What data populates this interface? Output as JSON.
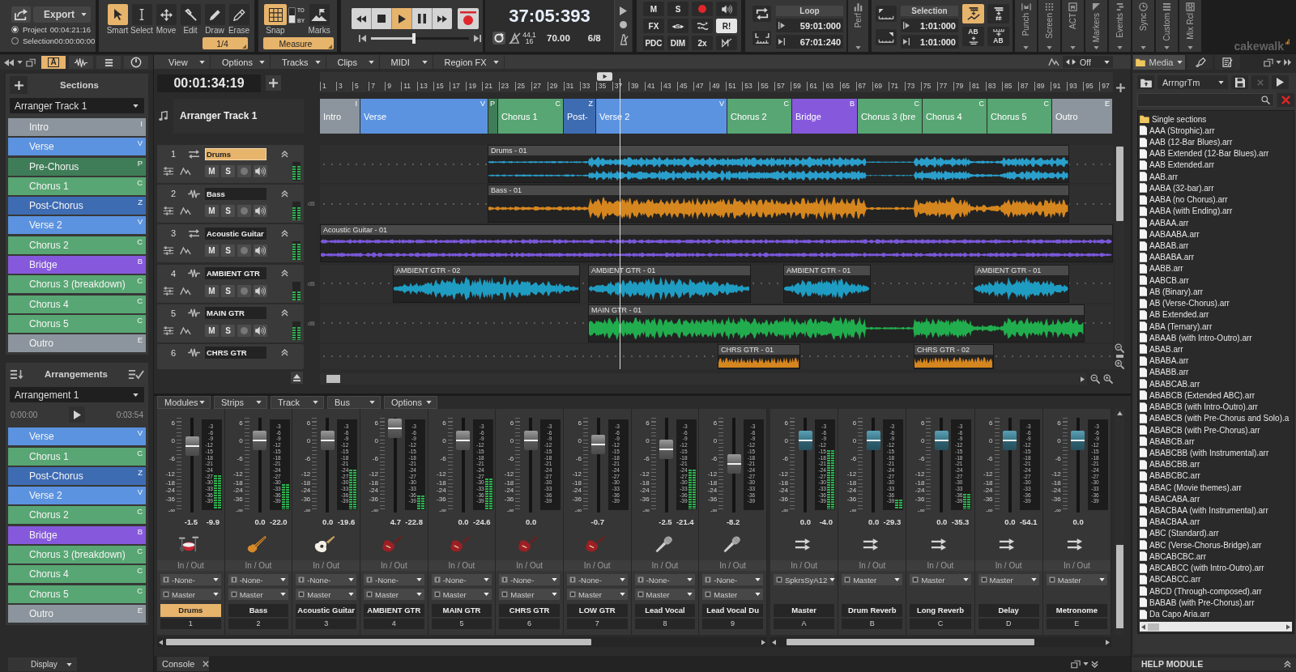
{
  "control_bar": {
    "export": {
      "label": "Export",
      "ranges": [
        {
          "label": "Project",
          "time": "00:04:21:16",
          "selected": true
        },
        {
          "label": "Selection",
          "time": "00:00:00:00",
          "selected": false
        }
      ]
    },
    "tools": {
      "items": [
        {
          "kind": "smart",
          "label": "Smart",
          "selected": true
        },
        {
          "kind": "select",
          "label": "Select",
          "selected": false
        },
        {
          "kind": "move",
          "label": "Move",
          "selected": false
        },
        {
          "kind": "edit",
          "label": "Edit",
          "selected": false
        },
        {
          "kind": "draw",
          "label": "Draw",
          "selected": false
        },
        {
          "kind": "erase",
          "label": "Erase",
          "selected": false
        }
      ],
      "resolution": "1/4"
    },
    "snap": {
      "label": "Snap",
      "on": true,
      "to_label": "TO",
      "by_label": "BY",
      "by": true,
      "marks_label": "Marks",
      "mode": "Measure"
    },
    "transport": {
      "buttons": [
        {
          "kind": "rewind",
          "on": false
        },
        {
          "kind": "stop",
          "on": false
        },
        {
          "kind": "play",
          "on": true
        },
        {
          "kind": "pause",
          "on": false
        },
        {
          "kind": "fast-forward",
          "on": false
        }
      ],
      "record": {
        "on": false
      },
      "position": {
        "level": 0.44
      }
    },
    "clock": {
      "time": "37:05:393",
      "sample_rate": "44.1",
      "bit_depth": "16",
      "tempo": "70.00",
      "meter": "6/8"
    },
    "mix": [
      {
        "kind": "text",
        "label": "M",
        "on": false
      },
      {
        "kind": "text",
        "label": "S",
        "on": false
      },
      {
        "kind": "record",
        "on": false
      },
      {
        "kind": "audio",
        "on": false
      },
      {
        "kind": "text",
        "label": "FX",
        "on": false
      },
      {
        "kind": "text",
        "label": "◂S▸",
        "on": false
      },
      {
        "kind": "bypass",
        "on": false
      },
      {
        "kind": "text",
        "label": "R!",
        "on": true
      },
      {
        "kind": "text",
        "label": "PDC",
        "on": false
      },
      {
        "kind": "text",
        "label": "DIM",
        "on": false
      },
      {
        "kind": "text",
        "label": "2x",
        "on": false
      },
      {
        "kind": "midi-off",
        "on": false
      }
    ],
    "loop": {
      "label": "Loop",
      "start": "59:01:000",
      "end": "67:01:240"
    },
    "perf": {
      "label": "Perf"
    },
    "selection": {
      "label": "Selection",
      "start": "1:01:000",
      "end": "1:01:000",
      "buttons": [
        {
          "kind": "automation",
          "on": true
        },
        {
          "kind": "tempo",
          "on": false
        },
        {
          "kind": "ab-above",
          "label": "AB",
          "on": false
        },
        {
          "kind": "ab-below",
          "label": "AB",
          "on": false
        }
      ]
    },
    "modules": [
      {
        "kind": "punch",
        "label": "Punch"
      },
      {
        "kind": "screen",
        "label": "Screen"
      },
      {
        "kind": "act",
        "label": "ACT"
      },
      {
        "kind": "markers",
        "label": "Markers"
      },
      {
        "kind": "events",
        "label": "Events"
      },
      {
        "kind": "sync",
        "label": "Sync"
      },
      {
        "kind": "custom",
        "label": "Custom"
      },
      {
        "kind": "mix-recall",
        "label": "Mix Rcl"
      }
    ],
    "logo": "cakewalk"
  },
  "inspector": {
    "tabs": [
      {
        "kind": "arranger",
        "label": "A",
        "selected": true
      },
      {
        "kind": "clip",
        "selected": false
      },
      {
        "kind": "list",
        "selected": false
      },
      {
        "kind": "knob",
        "selected": false
      }
    ],
    "sections": {
      "title": "Sections",
      "track": "Arranger Track 1",
      "items": [
        {
          "name": "Intro",
          "key": "I",
          "color": "#8c959d"
        },
        {
          "name": "Verse",
          "key": "V",
          "color": "#5b93e0"
        },
        {
          "name": "Pre-Chorus",
          "key": "P",
          "color": "#3f7d58"
        },
        {
          "name": "Chorus 1",
          "key": "C",
          "color": "#58a673"
        },
        {
          "name": "Post-Chorus",
          "key": "Z",
          "color": "#3e6cb3"
        },
        {
          "name": "Verse 2",
          "key": "V",
          "color": "#5b93e0"
        },
        {
          "name": "Chorus 2",
          "key": "C",
          "color": "#58a673"
        },
        {
          "name": "Bridge",
          "key": "B",
          "color": "#8659dc"
        },
        {
          "name": "Chorus 3 (breakdown)",
          "key": "C",
          "color": "#58a673"
        },
        {
          "name": "Chorus 4",
          "key": "C",
          "color": "#58a673"
        },
        {
          "name": "Chorus 5",
          "key": "C",
          "color": "#58a673"
        },
        {
          "name": "Outro",
          "key": "E",
          "color": "#8c959d"
        }
      ]
    },
    "arrangements": {
      "title": "Arrangements",
      "name": "Arrangement 1",
      "start": "0:00:00",
      "end": "0:03:54",
      "items": [
        {
          "name": "Verse",
          "key": "V",
          "color": "#5b93e0"
        },
        {
          "name": "Chorus 1",
          "key": "C",
          "color": "#58a673"
        },
        {
          "name": "Post-Chorus",
          "key": "Z",
          "color": "#3e6cb3"
        },
        {
          "name": "Verse 2",
          "key": "V",
          "color": "#5b93e0"
        },
        {
          "name": "Chorus 2",
          "key": "C",
          "color": "#58a673"
        },
        {
          "name": "Bridge",
          "key": "B",
          "color": "#8659dc"
        },
        {
          "name": "Chorus 3 (breakdown)",
          "key": "C",
          "color": "#58a673"
        },
        {
          "name": "Chorus 4",
          "key": "C",
          "color": "#58a673"
        },
        {
          "name": "Chorus 5",
          "key": "C",
          "color": "#58a673"
        },
        {
          "name": "Outro",
          "key": "E",
          "color": "#8c959d"
        }
      ]
    },
    "display": "Display"
  },
  "track_view": {
    "menu": [
      "View",
      "Options",
      "Tracks",
      "Clips",
      "MIDI",
      "Region FX"
    ],
    "dropdown": "Off",
    "now": "00:01:34:19",
    "ruler": [
      "1",
      "3",
      "5",
      "7",
      "9",
      "11",
      "13",
      "15",
      "17",
      "19",
      "21",
      "23",
      "25",
      "27",
      "29",
      "31",
      "33",
      "35",
      "37",
      "39",
      "41",
      "43",
      "45",
      "47",
      "49",
      "51",
      "53",
      "55",
      "57",
      "59",
      "61",
      "63",
      "65",
      "67",
      "69",
      "71",
      "73",
      "75",
      "77",
      "79",
      "81",
      "83",
      "85",
      "87",
      "89",
      "91",
      "93",
      "95",
      "97"
    ],
    "arranger": {
      "name": "Arranger Track 1",
      "sections": [
        {
          "name": "Intro",
          "key": "I",
          "color": "#8c959d"
        },
        {
          "name": "Verse",
          "key": "V",
          "color": "#5b93e0"
        },
        {
          "key": "P",
          "color": "#3f7d58"
        },
        {
          "name": "Chorus 1",
          "key": "C",
          "color": "#58a673"
        },
        {
          "name": "Post-",
          "key": "Z",
          "color": "#3e6cb3"
        },
        {
          "name": "Verse 2",
          "key": "V",
          "color": "#5b93e0"
        },
        {
          "name": "Chorus 2",
          "key": "C",
          "color": "#58a673"
        },
        {
          "name": "Bridge",
          "key": "B",
          "color": "#8659dc"
        },
        {
          "name": "Chorus 3 (bre",
          "key": "C",
          "color": "#58a673"
        },
        {
          "name": "Chorus 4",
          "key": "C",
          "color": "#58a673"
        },
        {
          "name": "Chorus 5",
          "key": "C",
          "color": "#58a673"
        },
        {
          "name": "Outro",
          "key": "E",
          "color": "#8c959d"
        }
      ]
    },
    "tracks": [
      {
        "number": "1",
        "name": "Drums",
        "kind": "stereo",
        "selected": true,
        "color": "#2a9fcc",
        "buttons": [
          "M",
          "S"
        ],
        "meter": {
          "level": 0.8
        },
        "clips": [
          {
            "name": "Drums - 01"
          }
        ]
      },
      {
        "number": "2",
        "name": "Bass",
        "kind": "mono",
        "selected": false,
        "color": "#d5861e",
        "buttons": [
          "M",
          "S"
        ],
        "meter": {
          "level": 0.7
        },
        "gain_label": "dB",
        "clips": [
          {
            "name": "Bass - 01"
          }
        ]
      },
      {
        "number": "3",
        "name": "Acoustic Guitar",
        "kind": "stereo",
        "selected": false,
        "color": "#7a57d8",
        "buttons": [
          "M",
          "S"
        ],
        "meter": {
          "level": 0.9
        },
        "clips": [
          {
            "name": "Acoustic Guitar - 01"
          }
        ]
      },
      {
        "number": "4",
        "name": "AMBIENT GTR",
        "kind": "mono",
        "selected": false,
        "color": "#1f9cc2",
        "buttons": [
          "M",
          "S"
        ],
        "meter": {
          "level": 0.45
        },
        "gain_label": "dB",
        "clips": [
          {
            "name": "AMBIENT GTR - 02"
          },
          {
            "name": "AMBIENT GTR - 01"
          },
          {
            "name": "AMBIENT GTR - 01"
          },
          {
            "name": "AMBIENT GTR - 01"
          }
        ]
      },
      {
        "number": "5",
        "name": "MAIN GTR",
        "kind": "mono",
        "selected": false,
        "color": "#21ad4d",
        "buttons": [
          "M",
          "S"
        ],
        "meter": {
          "level": 0.7
        },
        "gain_label": "dB",
        "clips": [
          {
            "name": "MAIN GTR - 01"
          }
        ]
      },
      {
        "number": "6",
        "name": "CHRS GTR",
        "kind": "mono",
        "selected": false,
        "color": "#d5861e",
        "clips": [
          {
            "name": "CHRS GTR - 01"
          },
          {
            "name": "CHRS GTR - 02"
          }
        ]
      }
    ]
  },
  "console": {
    "menu": [
      "Modules",
      "Strips",
      "Track",
      "Bus",
      "Options"
    ],
    "strips": [
      {
        "kind": "drums",
        "name": "Drums",
        "number": "1",
        "selected": true,
        "fader": {
          "level": 0.7
        },
        "meter": {
          "level": 0.39
        },
        "volume": "-1.5",
        "peak": "-9.9",
        "io_label": "In / Out",
        "input": "-None-",
        "output": "Master",
        "fader_scale": [
          "6",
          "0",
          "-6",
          "-12",
          "-18",
          "-24",
          "-36",
          "-∞"
        ],
        "meter_scale": [
          "-3",
          "-6",
          "-9",
          "-12",
          "-15",
          "-18",
          "-21",
          "-24",
          "-27",
          "-30",
          "-33",
          "-36",
          "-39"
        ]
      },
      {
        "kind": "bass",
        "name": "Bass",
        "number": "2",
        "selected": false,
        "fader": {
          "level": 0.76
        },
        "meter": {
          "level": 0.28
        },
        "volume": "0.0",
        "peak": "-22.0",
        "io_label": "In / Out",
        "input": "-None-",
        "output": "Master",
        "fader_scale": [
          "6",
          "0",
          "-6",
          "-12",
          "-18",
          "-24",
          "-36",
          "-∞"
        ],
        "meter_scale": [
          "-3",
          "-6",
          "-9",
          "-12",
          "-15",
          "-18",
          "-21",
          "-24",
          "-27",
          "-30",
          "-33",
          "-36",
          "-39"
        ]
      },
      {
        "kind": "acoustic-guitar",
        "name": "Acoustic Guitar",
        "number": "3",
        "selected": false,
        "fader": {
          "level": 0.76
        },
        "meter": {
          "level": 0.45
        },
        "volume": "0.0",
        "peak": "-19.6",
        "io_label": "In / Out",
        "input": "-None-",
        "output": "Master",
        "fader_scale": [
          "6",
          "0",
          "-6",
          "-12",
          "-18",
          "-24",
          "-36",
          "-∞"
        ],
        "meter_scale": [
          "-3",
          "-6",
          "-9",
          "-12",
          "-15",
          "-18",
          "-21",
          "-24",
          "-27",
          "-30",
          "-33",
          "-36",
          "-39"
        ]
      },
      {
        "kind": "electric-guitar",
        "name": "AMBIENT GTR",
        "number": "4",
        "selected": false,
        "fader": {
          "level": 0.89
        },
        "meter": {
          "level": 0.16
        },
        "volume": "4.7",
        "peak": "-22.8",
        "io_label": "In / Out",
        "input": "-None-",
        "output": "Master",
        "fader_scale": [
          "6",
          "0",
          "-6",
          "-12",
          "-18",
          "-24",
          "-36",
          "-∞"
        ],
        "meter_scale": [
          "-3",
          "-6",
          "-9",
          "-12",
          "-15",
          "-18",
          "-21",
          "-24",
          "-27",
          "-30",
          "-33",
          "-36",
          "-39"
        ]
      },
      {
        "kind": "electric-guitar",
        "name": "MAIN GTR",
        "number": "5",
        "selected": false,
        "fader": {
          "level": 0.76
        },
        "meter": {
          "level": 0.35
        },
        "volume": "0.0",
        "peak": "-24.6",
        "io_label": "In / Out",
        "input": "-None-",
        "output": "Master",
        "fader_scale": [
          "6",
          "0",
          "-6",
          "-12",
          "-18",
          "-24",
          "-36",
          "-∞"
        ],
        "meter_scale": [
          "-3",
          "-6",
          "-9",
          "-12",
          "-15",
          "-18",
          "-21",
          "-24",
          "-27",
          "-30",
          "-33",
          "-36",
          "-39"
        ]
      },
      {
        "kind": "electric-guitar",
        "name": "CHRS GTR",
        "number": "6",
        "selected": false,
        "fader": {
          "level": 0.76
        },
        "meter": {
          "level": 0
        },
        "volume": "0.0",
        "io_label": "In / Out",
        "input": "-None-",
        "output": "Master",
        "fader_scale": [
          "6",
          "0",
          "-6",
          "-12",
          "-18",
          "-24",
          "-36",
          "-∞"
        ],
        "meter_scale": [
          "-3",
          "-6",
          "-9",
          "-12",
          "-15",
          "-18",
          "-21",
          "-24",
          "-27",
          "-30",
          "-33",
          "-36",
          "-39"
        ]
      },
      {
        "kind": "electric-guitar",
        "name": "LOW GTR",
        "number": "7",
        "selected": false,
        "fader": {
          "level": 0.72
        },
        "meter": {
          "level": 0
        },
        "volume": "-0.7",
        "io_label": "In / Out",
        "input": "-None-",
        "output": "Master",
        "fader_scale": [
          "6",
          "0",
          "-6",
          "-12",
          "-18",
          "-24",
          "-36",
          "-∞"
        ],
        "meter_scale": [
          "-3",
          "-6",
          "-9",
          "-12",
          "-15",
          "-18",
          "-21",
          "-24",
          "-27",
          "-30",
          "-33",
          "-36",
          "-39"
        ]
      },
      {
        "kind": "microphone",
        "name": "Lead Vocal",
        "number": "8",
        "selected": false,
        "fader": {
          "level": 0.67
        },
        "meter": {
          "level": 0.45
        },
        "volume": "-2.5",
        "peak": "-21.4",
        "io_label": "In / Out",
        "input": "-None-",
        "output": "Master",
        "fader_scale": [
          "6",
          "0",
          "-6",
          "-12",
          "-18",
          "-24",
          "-36",
          "-∞"
        ],
        "meter_scale": [
          "-3",
          "-6",
          "-9",
          "-12",
          "-15",
          "-18",
          "-21",
          "-24",
          "-27",
          "-30",
          "-33",
          "-36",
          "-39"
        ]
      },
      {
        "kind": "microphone",
        "name": "Lead Vocal Du",
        "number": "9",
        "selected": false,
        "fader": {
          "level": 0.51
        },
        "meter": {
          "level": 0
        },
        "volume": "-8.2",
        "io_label": "In / Out",
        "input": "-None-",
        "output": "Master",
        "fader_scale": [
          "6",
          "0",
          "-6",
          "-12",
          "-18",
          "-24",
          "-36",
          "-∞"
        ],
        "meter_scale": [
          "-3",
          "-6",
          "-9",
          "-12",
          "-15",
          "-18",
          "-21",
          "-24",
          "-27",
          "-30",
          "-33",
          "-36",
          "-39"
        ]
      },
      {
        "kind": "bus",
        "name": "Master",
        "number": "A",
        "selected": false,
        "fader": {
          "level": 0.76
        },
        "meter": {
          "level": 0.67
        },
        "volume": "0.0",
        "peak": "-4.0",
        "io_label": "In / Out",
        "output": "SpkrsSyA12",
        "fader_scale": [
          "6",
          "0",
          "-6",
          "-12",
          "-18",
          "-24",
          "-36",
          "-∞"
        ],
        "meter_scale": [
          "-3",
          "-6",
          "-9",
          "-12",
          "-15",
          "-18",
          "-21",
          "-24",
          "-27",
          "-30",
          "-33",
          "-36",
          "-39"
        ]
      },
      {
        "kind": "bus",
        "name": "Drum Reverb",
        "number": "B",
        "selected": false,
        "fader": {
          "level": 0.76
        },
        "meter": {
          "level": 0.11
        },
        "volume": "0.0",
        "peak": "-29.3",
        "io_label": "In / Out",
        "output": "Master",
        "fader_scale": [
          "6",
          "0",
          "-6",
          "-12",
          "-18",
          "-24",
          "-36",
          "-∞"
        ],
        "meter_scale": [
          "-3",
          "-6",
          "-9",
          "-12",
          "-15",
          "-18",
          "-21",
          "-24",
          "-27",
          "-30",
          "-33",
          "-36",
          "-39"
        ]
      },
      {
        "kind": "bus",
        "name": "Long Reverb",
        "number": "C",
        "selected": false,
        "fader": {
          "level": 0.76
        },
        "meter": {
          "level": 0.17
        },
        "volume": "0.0",
        "peak": "-35.3",
        "io_label": "In / Out",
        "output": "Master",
        "fader_scale": [
          "6",
          "0",
          "-6",
          "-12",
          "-18",
          "-24",
          "-36",
          "-∞"
        ],
        "meter_scale": [
          "-3",
          "-6",
          "-9",
          "-12",
          "-15",
          "-18",
          "-21",
          "-24",
          "-27",
          "-30",
          "-33",
          "-36",
          "-39"
        ]
      },
      {
        "kind": "bus",
        "name": "Delay",
        "number": "D",
        "selected": false,
        "fader": {
          "level": 0.76
        },
        "meter": {
          "level": 0
        },
        "volume": "0.0",
        "peak": "-54.1",
        "io_label": "In / Out",
        "output": "Master",
        "fader_scale": [
          "6",
          "0",
          "-6",
          "-12",
          "-18",
          "-24",
          "-36",
          "-∞"
        ],
        "meter_scale": [
          "-3",
          "-6",
          "-9",
          "-12",
          "-15",
          "-18",
          "-21",
          "-24",
          "-27",
          "-30",
          "-33",
          "-36",
          "-39"
        ]
      },
      {
        "kind": "bus",
        "name": "Metronome",
        "number": "E",
        "selected": false,
        "fader": {
          "level": 0.76
        },
        "meter": {
          "level": 0
        },
        "volume": "0.0",
        "io_label": "In / Out",
        "output": "Master",
        "fader_scale": [
          "6",
          "0",
          "-6",
          "-12",
          "-18",
          "-24",
          "-36",
          "-∞"
        ],
        "meter_scale": [
          "-3",
          "-6",
          "-9",
          "-12",
          "-15",
          "-18",
          "-21",
          "-24",
          "-27",
          "-30",
          "-33",
          "-36",
          "-39"
        ]
      }
    ],
    "tab": "Console"
  },
  "browser": {
    "tabs": [
      {
        "kind": "media",
        "label": "Media",
        "selected": true
      },
      {
        "kind": "plugins",
        "selected": false
      },
      {
        "kind": "notes",
        "selected": false
      }
    ],
    "folder": "ArrngrTm",
    "items": [
      {
        "kind": "folder",
        "name": "Single sections"
      },
      {
        "kind": "file",
        "name": "AAA (Strophic).arr"
      },
      {
        "kind": "file",
        "name": "AAB (12-Bar Blues).arr"
      },
      {
        "kind": "file",
        "name": "AAB Extended (12-Bar Blues).arr"
      },
      {
        "kind": "file",
        "name": "AAB Extended.arr"
      },
      {
        "kind": "file",
        "name": "AAB.arr"
      },
      {
        "kind": "file",
        "name": "AABA (32-bar).arr"
      },
      {
        "kind": "file",
        "name": "AABA (no Chorus).arr"
      },
      {
        "kind": "file",
        "name": "AABA (with Ending).arr"
      },
      {
        "kind": "file",
        "name": "AABAA.arr"
      },
      {
        "kind": "file",
        "name": "AABAABA.arr"
      },
      {
        "kind": "file",
        "name": "AABAB.arr"
      },
      {
        "kind": "file",
        "name": "AABABA.arr"
      },
      {
        "kind": "file",
        "name": "AABB.arr"
      },
      {
        "kind": "file",
        "name": "AABCB.arr"
      },
      {
        "kind": "file",
        "name": "AB (Binary).arr"
      },
      {
        "kind": "file",
        "name": "AB (Verse-Chorus).arr"
      },
      {
        "kind": "file",
        "name": "AB Extended.arr"
      },
      {
        "kind": "file",
        "name": "ABA (Ternary).arr"
      },
      {
        "kind": "file",
        "name": "ABAAB (with Intro-Outro).arr"
      },
      {
        "kind": "file",
        "name": "ABAB.arr"
      },
      {
        "kind": "file",
        "name": "ABABA.arr"
      },
      {
        "kind": "file",
        "name": "ABABB.arr"
      },
      {
        "kind": "file",
        "name": "ABABCAB.arr"
      },
      {
        "kind": "file",
        "name": "ABABCB (Extended ABC).arr"
      },
      {
        "kind": "file",
        "name": "ABABCB (with Intro-Outro).arr"
      },
      {
        "kind": "file",
        "name": "ABABCB (with Pre-Chorus and Solo).a"
      },
      {
        "kind": "file",
        "name": "ABABCB (with Pre-Chorus).arr"
      },
      {
        "kind": "file",
        "name": "ABABCB.arr"
      },
      {
        "kind": "file",
        "name": "ABABCBB (with Instrumental).arr"
      },
      {
        "kind": "file",
        "name": "ABABCBB.arr"
      },
      {
        "kind": "file",
        "name": "ABABCBC.arr"
      },
      {
        "kind": "file",
        "name": "ABAC (Movie themes).arr"
      },
      {
        "kind": "file",
        "name": "ABACABA.arr"
      },
      {
        "kind": "file",
        "name": "ABACBAA (with Instrumental).arr"
      },
      {
        "kind": "file",
        "name": "ABACBAA.arr"
      },
      {
        "kind": "file",
        "name": "ABC (Standard).arr"
      },
      {
        "kind": "file",
        "name": "ABC (Verse-Chorus-Bridge).arr"
      },
      {
        "kind": "file",
        "name": "ABCABCBC.arr"
      },
      {
        "kind": "file",
        "name": "ABCABCC (with Intro-Outro).arr"
      },
      {
        "kind": "file",
        "name": "ABCABCC.arr"
      },
      {
        "kind": "file",
        "name": "ABCD (Through-composed).arr"
      },
      {
        "kind": "file",
        "name": "BABAB (with Pre-Chorus).arr"
      },
      {
        "kind": "file",
        "name": "Da Capo Aria.arr"
      }
    ],
    "help": "HELP MODULE"
  }
}
